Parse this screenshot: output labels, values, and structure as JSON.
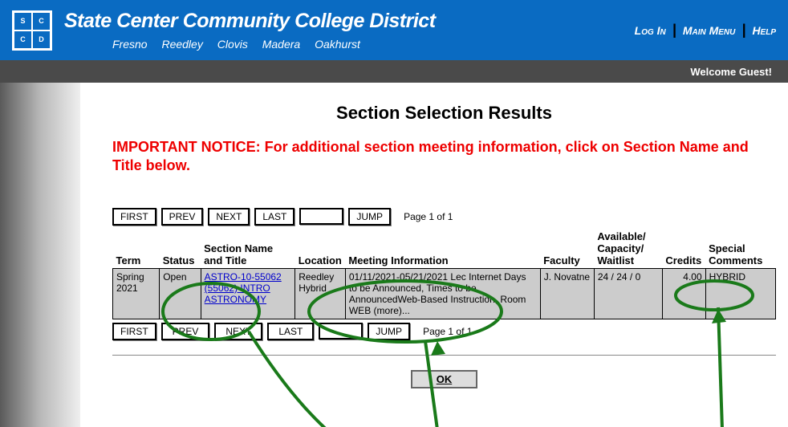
{
  "header": {
    "title": "State Center Community College District",
    "campuses": "Fresno Reedley Clovis Madera Oakhurst",
    "links": {
      "login": "Log In",
      "mainmenu": "Main Menu",
      "help": "Help"
    }
  },
  "menubar": {
    "welcome": "Welcome Guest!"
  },
  "page": {
    "title": "Section Selection Results",
    "notice": "IMPORTANT NOTICE: For additional section meeting information, click on Section Name and Title below."
  },
  "pager": {
    "first": "FIRST",
    "prev": "PREV",
    "next": "NEXT",
    "last": "LAST",
    "jump": "JUMP",
    "page_of": "Page 1 of 1"
  },
  "table": {
    "headers": {
      "term": "Term",
      "status": "Status",
      "section": "Section Name and Title",
      "location": "Location",
      "meeting": "Meeting Information",
      "faculty": "Faculty",
      "avail": "Available/ Capacity/ Waitlist",
      "credits": "Credits",
      "comments": "Special Comments"
    },
    "row": {
      "term": "Spring 2021",
      "status": "Open",
      "section_link": "ASTRO-10-55062 (55062) INTRO ASTRONOMY",
      "location": "Reedley Hybrid",
      "meeting": "01/11/2021-05/21/2021 Lec Internet Days to be Announced, Times to be AnnouncedWeb-Based Instruction, Room WEB (more)...",
      "faculty": "J. Novatne",
      "avail": "24 / 24 / 0",
      "credits": "4.00",
      "comments": "HYBRID"
    }
  },
  "buttons": {
    "ok": "OK"
  }
}
